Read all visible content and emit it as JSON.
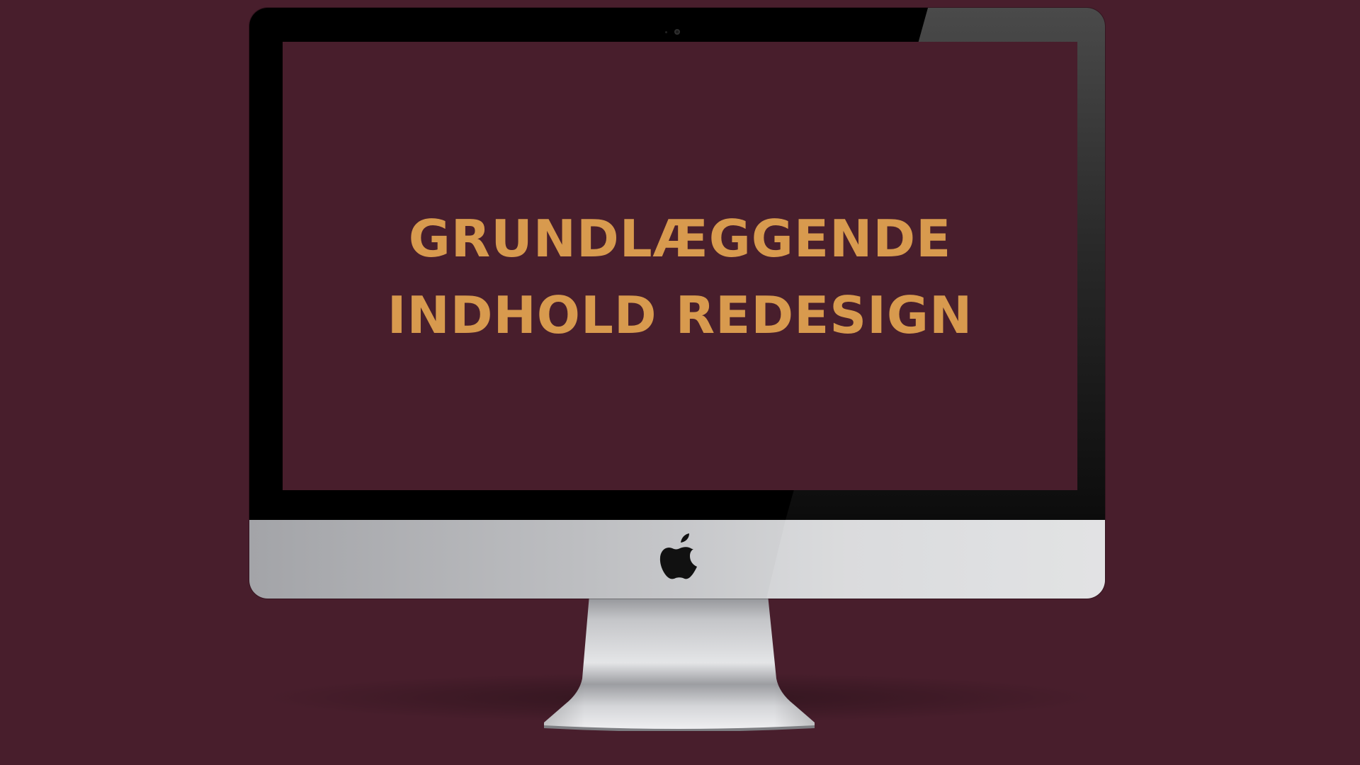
{
  "screen": {
    "headline": "GRUNDLÆGGENDE INDHOLD REDESIGN"
  },
  "colors": {
    "background": "#481e2c",
    "headline_text": "#d89a4e",
    "bezel": "#000000",
    "chin": "#c9cacd"
  },
  "icons": {
    "logo": "apple-logo-icon",
    "camera": "camera-icon"
  }
}
